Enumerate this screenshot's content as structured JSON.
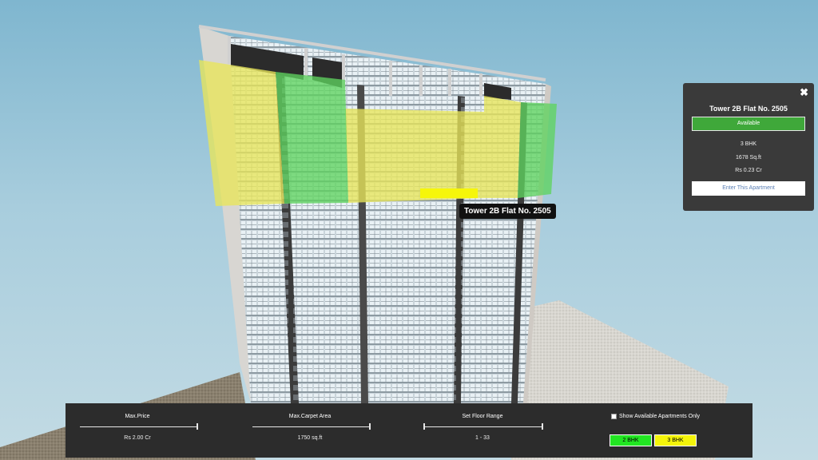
{
  "tooltip": {
    "text": "Tower 2B Flat No. 2505"
  },
  "info_panel": {
    "close_icon": "close-icon",
    "title": "Tower 2B Flat No. 2505",
    "status": "Available",
    "bhk": "3 BHK",
    "area": "1678 Sq.ft",
    "price": "Rs 0.23 Cr",
    "enter_label": "Enter This Apartment",
    "status_color": "#3fa83a"
  },
  "filters": {
    "max_price": {
      "label": "Max.Price",
      "value": "Rs 2.00 Cr"
    },
    "max_carpet_area": {
      "label": "Max.Carpet Area",
      "value": "1750 sq.ft"
    },
    "floor_range": {
      "label": "Set Floor Range",
      "value": "1 - 33"
    },
    "available_only": {
      "label": "Show Available Apartments Only",
      "checked": false
    }
  },
  "legend": [
    {
      "label": "2 BHK",
      "color": "#22e622"
    },
    {
      "label": "3 BHK",
      "color": "#f4f40a"
    }
  ],
  "colors": {
    "highlight_2bhk": "#5fd35f",
    "highlight_3bhk": "#e8e65a",
    "selected_flat": "#f6f60a"
  }
}
